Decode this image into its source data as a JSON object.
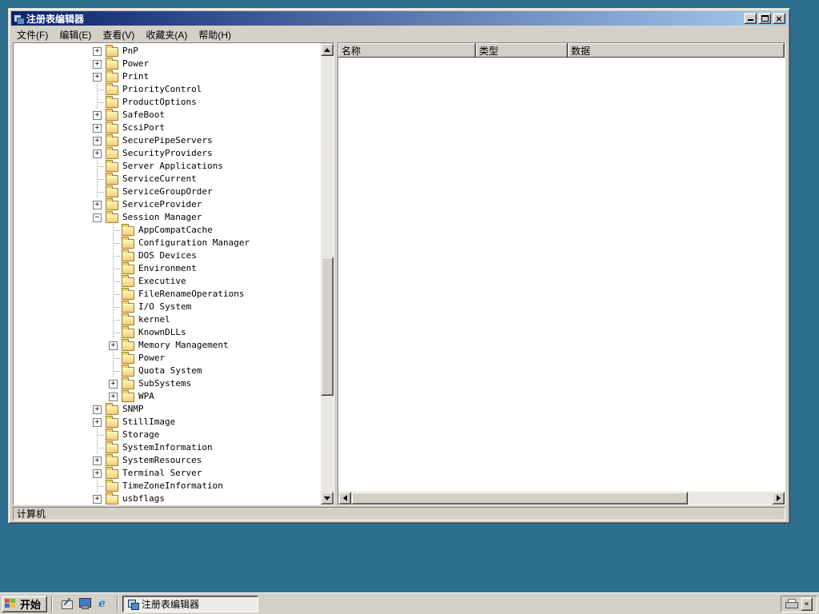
{
  "window": {
    "title": "注册表编辑器",
    "controls": {
      "minimize": "最小化",
      "maximize": "最大化",
      "close": "关闭"
    },
    "menu": [
      "文件(F)",
      "编辑(E)",
      "查看(V)",
      "收藏夹(A)",
      "帮助(H)"
    ],
    "status": "计算机"
  },
  "list": {
    "columns": [
      "名称",
      "类型",
      "数据"
    ]
  },
  "tree": {
    "items": [
      {
        "label": "PnP",
        "level": 0,
        "expand": "plus"
      },
      {
        "label": "Power",
        "level": 0,
        "expand": "plus"
      },
      {
        "label": "Print",
        "level": 0,
        "expand": "plus"
      },
      {
        "label": "PriorityControl",
        "level": 0,
        "expand": "none"
      },
      {
        "label": "ProductOptions",
        "level": 0,
        "expand": "none"
      },
      {
        "label": "SafeBoot",
        "level": 0,
        "expand": "plus"
      },
      {
        "label": "ScsiPort",
        "level": 0,
        "expand": "plus"
      },
      {
        "label": "SecurePipeServers",
        "level": 0,
        "expand": "plus"
      },
      {
        "label": "SecurityProviders",
        "level": 0,
        "expand": "plus"
      },
      {
        "label": "Server Applications",
        "level": 0,
        "expand": "none"
      },
      {
        "label": "ServiceCurrent",
        "level": 0,
        "expand": "none"
      },
      {
        "label": "ServiceGroupOrder",
        "level": 0,
        "expand": "none"
      },
      {
        "label": "ServiceProvider",
        "level": 0,
        "expand": "plus"
      },
      {
        "label": "Session Manager",
        "level": 0,
        "expand": "minus"
      },
      {
        "label": "AppCompatCache",
        "level": 1,
        "expand": "none"
      },
      {
        "label": "Configuration Manager",
        "level": 1,
        "expand": "none"
      },
      {
        "label": "DOS Devices",
        "level": 1,
        "expand": "none"
      },
      {
        "label": "Environment",
        "level": 1,
        "expand": "none"
      },
      {
        "label": "Executive",
        "level": 1,
        "expand": "none"
      },
      {
        "label": "FileRenameOperations",
        "level": 1,
        "expand": "none"
      },
      {
        "label": "I/O System",
        "level": 1,
        "expand": "none"
      },
      {
        "label": "kernel",
        "level": 1,
        "expand": "none"
      },
      {
        "label": "KnownDLLs",
        "level": 1,
        "expand": "none"
      },
      {
        "label": "Memory Management",
        "level": 1,
        "expand": "plus"
      },
      {
        "label": "Power",
        "level": 1,
        "expand": "none"
      },
      {
        "label": "Quota System",
        "level": 1,
        "expand": "none"
      },
      {
        "label": "SubSystems",
        "level": 1,
        "expand": "plus"
      },
      {
        "label": "WPA",
        "level": 1,
        "expand": "plus"
      },
      {
        "label": "SNMP",
        "level": 0,
        "expand": "plus"
      },
      {
        "label": "StillImage",
        "level": 0,
        "expand": "plus"
      },
      {
        "label": "Storage",
        "level": 0,
        "expand": "none"
      },
      {
        "label": "SystemInformation",
        "level": 0,
        "expand": "none"
      },
      {
        "label": "SystemResources",
        "level": 0,
        "expand": "plus"
      },
      {
        "label": "Terminal Server",
        "level": 0,
        "expand": "plus"
      },
      {
        "label": "TimeZoneInformation",
        "level": 0,
        "expand": "none"
      },
      {
        "label": "usbflags",
        "level": 0,
        "expand": "plus"
      }
    ]
  },
  "taskbar": {
    "start_label": "开始",
    "task_button": "注册表编辑器",
    "tray_chevron": "«"
  },
  "icons": {
    "close_glyph": "×",
    "app": "registry-icon",
    "quick_launch": [
      "show-desktop-icon",
      "monitor-icon",
      "internet-explorer-icon"
    ],
    "tray": [
      "printer-icon"
    ]
  },
  "colors": {
    "desktop": "#2e6e8e",
    "chrome": "#d4d0c8",
    "titlebar_start": "#0a246a",
    "titlebar_end": "#a6caf0"
  }
}
